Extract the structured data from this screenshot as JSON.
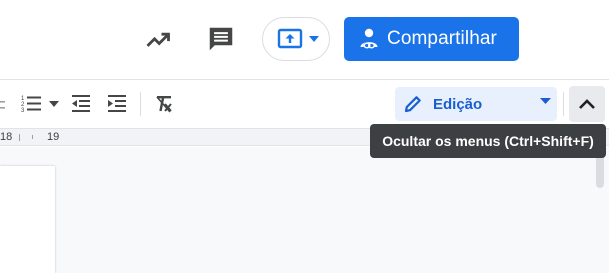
{
  "header": {
    "share_label": "Compartilhar"
  },
  "toolbar": {
    "mode_label": "Edição"
  },
  "ruler": {
    "left_number": "18",
    "right_number": "19"
  },
  "tooltip": {
    "text": "Ocultar os menus (Ctrl+Shift+F)"
  },
  "colors": {
    "accent": "#1a73e8",
    "mode_bg": "#e8f0fe",
    "tooltip_bg": "#3c4043"
  },
  "icons": {
    "activity": "trending-up-icon",
    "comments": "comment-icon",
    "present": "present-to-all-icon",
    "share": "person-link-icon",
    "numbered_list": "numbered-list-icon",
    "decrease_indent": "decrease-indent-icon",
    "increase_indent": "increase-indent-icon",
    "clear_formatting": "clear-formatting-icon",
    "pencil": "pencil-icon",
    "collapse": "chevron-up-icon"
  }
}
